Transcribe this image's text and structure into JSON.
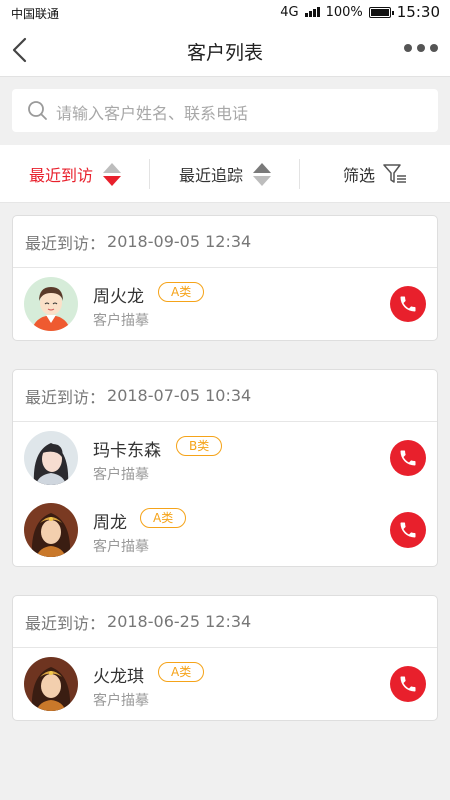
{
  "status_bar": {
    "carrier": "中国联通",
    "network": "4G",
    "battery": "100%",
    "time": "15:30"
  },
  "nav": {
    "title": "客户列表",
    "back_icon": "chevron-left-icon",
    "more_icon": "more-dots-icon"
  },
  "search": {
    "placeholder": "请输入客户姓名、联系电话",
    "icon": "search-icon"
  },
  "filters": [
    {
      "label": "最近到访",
      "active": true,
      "icon": "sort-icon"
    },
    {
      "label": "最近追踪",
      "active": false,
      "icon": "sort-icon"
    },
    {
      "label": "筛选",
      "active": false,
      "icon": "filter-icon"
    }
  ],
  "groups": [
    {
      "visit_label": "最近到访：",
      "visit_time": "2018-09-05  12:34",
      "customers": [
        {
          "name": "周火龙",
          "category": "A类",
          "description": "客户描摹"
        }
      ]
    },
    {
      "visit_label": "最近到访：",
      "visit_time": "2018-07-05  10:34",
      "customers": [
        {
          "name": "玛卡东森",
          "category": "B类",
          "description": "客户描摹"
        },
        {
          "name": "周龙",
          "category": "A类",
          "description": "客户描摹"
        }
      ]
    },
    {
      "visit_label": "最近到访：",
      "visit_time": "2018-06-25  12:34",
      "customers": [
        {
          "name": "火龙琪",
          "category": "A类",
          "description": "客户描摹"
        }
      ]
    }
  ],
  "colors": {
    "accent": "#e8202c",
    "badge": "#f5a319",
    "background": "#f0f0f0"
  }
}
